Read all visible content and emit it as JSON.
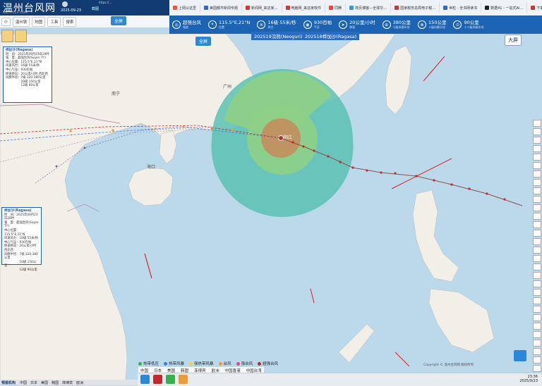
{
  "site": {
    "logo": "温州台风网",
    "sub": "WZTF123.COM",
    "date": "2025-09-23",
    "mid_label": "截图",
    "addr": "https://..."
  },
  "browser_tabs": [
    {
      "label": "上网从这里",
      "color": "#e54"
    },
    {
      "label": "美国都市新闻专题",
      "color": "#36c"
    },
    {
      "label": "新闻网_来这家…",
      "color": "#d33"
    },
    {
      "label": "电脑网_来这家软件",
      "color": "#d33"
    },
    {
      "label": "同腾",
      "color": "#e44"
    },
    {
      "label": "简页博客—全球华…",
      "color": "#39c"
    },
    {
      "label": "国家税务总局电子税…",
      "color": "#c33"
    },
    {
      "label": "世粒 - 全书网读书",
      "color": "#36c"
    },
    {
      "label": "数据41 - 一站式AI…",
      "color": "#222"
    },
    {
      "label": "下载",
      "color": "#c33"
    }
  ],
  "toolbar": {
    "items": [
      "温州铁",
      "地图",
      "工具",
      "搜索"
    ],
    "full": "全屏"
  },
  "info_items": [
    {
      "icon": "◎",
      "value": "超强台风",
      "sub": "强度"
    },
    {
      "icon": "⌖",
      "value": "115.5°E,21°N",
      "sub": "位置"
    },
    {
      "icon": "≋",
      "value": "16级 55米/秒",
      "sub": "风力"
    },
    {
      "icon": "◉",
      "value": "930百帕",
      "sub": "气压"
    },
    {
      "icon": "➤",
      "value": "20公里/小时",
      "sub": "移速"
    },
    {
      "icon": "⊕",
      "value": "380公里",
      "sub": "七级风圈半径"
    },
    {
      "icon": "⊗",
      "value": "150公里",
      "sub": "十级风圈半径"
    },
    {
      "icon": "⊙",
      "value": "90公里",
      "sub": "十二级风圈半径"
    }
  ],
  "big_screen": "大屏",
  "typhoon_tabs": [
    "202519浣熊(Neoguri)",
    "202518桦加沙(Ragasa)"
  ],
  "quanping": "全屏",
  "infobox_top": {
    "title": "桦加沙(Ragasa)",
    "lines": [
      "时　间：2025年09月23日20时",
      "强　度：超强台风(Super TY)",
      "中心位置：115.5°E,21°N",
      "风速风力：16级 55米/秒",
      "中心气压：930百帕",
      "移速移向：20公里/小时 西北西",
      "风圈半径：7级 320-380公里",
      "　　　　　10级 150公里",
      "　　　　　12级 90公里"
    ]
  },
  "infobox_bottom": {
    "title": "桦加沙(Ragasa)",
    "lines": [
      "时　间：2025年09月23日20时",
      "强　度：超强台风(Super TY)",
      "中心位置：115.5°E,21°N",
      "风速风力：16级 55米/秒",
      "中心气压：930百帕",
      "移速移向：20公里/小时 西北西",
      "风圈半径：7级 320-380公里",
      "　　　　　10级 150公里",
      "　　　　　12级 90公里"
    ]
  },
  "map_labels": {
    "nanning": "南宁",
    "guangzhou": "广州",
    "haikou": "海口",
    "yangjiang": "阳江"
  },
  "legend_intensity": [
    {
      "label": "热带低压",
      "color": "#34b34a"
    },
    {
      "label": "热带风暴",
      "color": "#3c7de0"
    },
    {
      "label": "强热带风暴",
      "color": "#f0d23a"
    },
    {
      "label": "台风",
      "color": "#f09a33"
    },
    {
      "label": "强台风",
      "color": "#e0497e"
    },
    {
      "label": "超强台风",
      "color": "#c8262a"
    }
  ],
  "legend_agencies": [
    "中国",
    "日本",
    "美国",
    "韩国",
    "菲律宾",
    "欧洲",
    "中国香港",
    "中国台湾"
  ],
  "bottom_left": "预报机构",
  "copyright": "Copyright © 温州台风网 版权所有",
  "clock": {
    "time": "23:36",
    "date": "2025/9/23"
  },
  "colors": {
    "header": "#123b73",
    "infobar": "#1d63b4",
    "wind7": "#5bc1b3",
    "wind10": "#8ecf86",
    "wind12": "#c98a5a"
  }
}
